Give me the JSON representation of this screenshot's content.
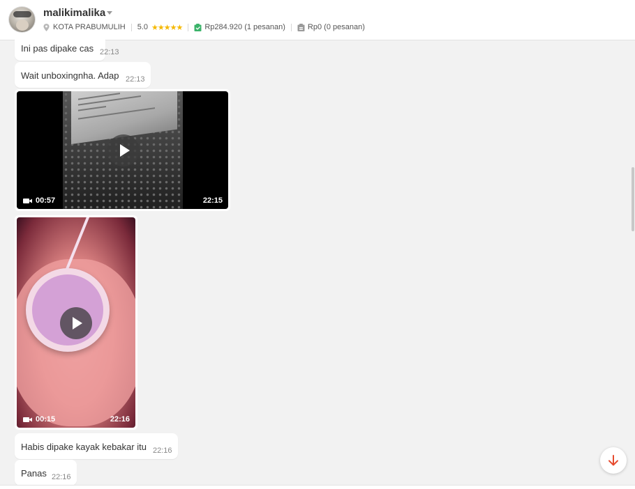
{
  "header": {
    "username": "malikimalika",
    "location": "KOTA PRABUMULIH",
    "rating": "5.0",
    "stars": "★★★★★",
    "completed_orders": "Rp284.920 (1 pesanan)",
    "pending_orders": "Rp0 (0 pesanan)"
  },
  "messages": [
    {
      "text": "Ini pas dipake cas",
      "time": "22:13"
    },
    {
      "text": "Wait unboxingnha. Adap",
      "time": "22:13"
    },
    {
      "text": "Habis dipake kayak kebakar itu",
      "time": "22:16"
    },
    {
      "text": "Panas",
      "time": "22:16"
    }
  ],
  "videos": [
    {
      "duration": "00:57",
      "time": "22:15"
    },
    {
      "duration": "00:15",
      "time": "22:16"
    }
  ],
  "colors": {
    "accent_green": "#3bb36a",
    "star": "#f5b800",
    "scroll_arrow": "#e64a2e"
  },
  "icons": {
    "location": "location-pin-icon",
    "orders_done": "shopping-bag-check-icon",
    "orders_pending": "shopping-bag-pending-icon",
    "video": "video-camera-icon",
    "play": "play-icon",
    "scroll": "arrow-down-icon"
  }
}
